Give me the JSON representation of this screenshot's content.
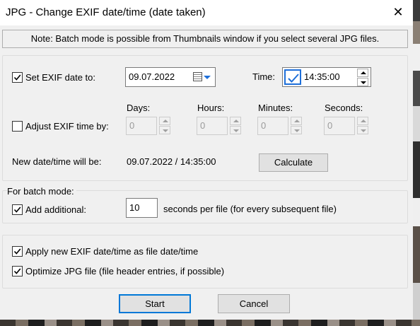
{
  "window": {
    "title": "JPG - Change EXIF date/time (date taken)"
  },
  "note": "Note: Batch mode is possible from Thumbnails window if you select several JPG files.",
  "set_date": {
    "label": "Set EXIF date to:",
    "checked": true,
    "date_value": "09.07.2022"
  },
  "time": {
    "label": "Time:",
    "checked": true,
    "value": "14:35:00"
  },
  "adjust": {
    "label": "Adjust EXIF time by:",
    "checked": false,
    "days_label": "Days:",
    "days_value": "0",
    "hours_label": "Hours:",
    "hours_value": "0",
    "minutes_label": "Minutes:",
    "minutes_value": "0",
    "seconds_label": "Seconds:",
    "seconds_value": "0"
  },
  "result": {
    "label": "New date/time will be:",
    "value": "09.07.2022 / 14:35:00",
    "calculate_label": "Calculate"
  },
  "batch": {
    "header": "For batch mode:",
    "add_label": "Add additional:",
    "add_checked": true,
    "add_value": "10",
    "suffix": "seconds per file (for every subsequent file)"
  },
  "options": {
    "apply_label": "Apply new EXIF date/time as file date/time",
    "apply_checked": true,
    "optimize_label": "Optimize JPG file (file header entries, if possible)",
    "optimize_checked": true
  },
  "buttons": {
    "start": "Start",
    "cancel": "Cancel"
  },
  "colors": {
    "accent": "#0078d7",
    "dialog_bg": "#f0f0f0",
    "check_blue": "#1e6fd9"
  }
}
